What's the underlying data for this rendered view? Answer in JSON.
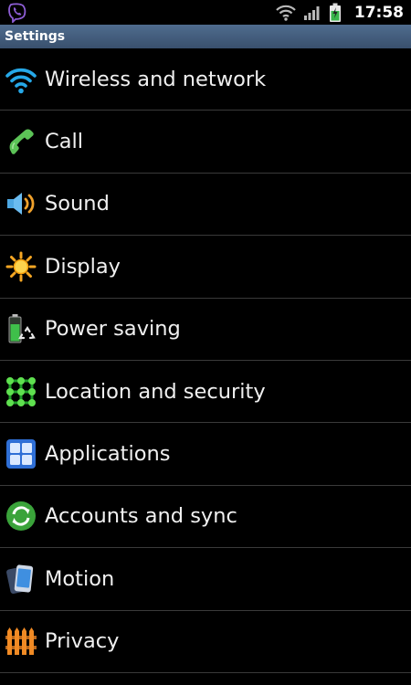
{
  "status_bar": {
    "time": "17:58",
    "icons": [
      "viber-icon",
      "wifi-signal-icon",
      "cell-signal-icon",
      "battery-charging-icon"
    ]
  },
  "title_bar": {
    "title": "Settings"
  },
  "settings": {
    "items": [
      {
        "label": "Wireless and network",
        "icon": "wifi-icon"
      },
      {
        "label": "Call",
        "icon": "phone-handset-icon"
      },
      {
        "label": "Sound",
        "icon": "speaker-icon"
      },
      {
        "label": "Display",
        "icon": "sun-icon"
      },
      {
        "label": "Power saving",
        "icon": "battery-recycle-icon"
      },
      {
        "label": "Location and security",
        "icon": "pattern-lock-icon"
      },
      {
        "label": "Applications",
        "icon": "app-grid-icon"
      },
      {
        "label": "Accounts and sync",
        "icon": "sync-icon"
      },
      {
        "label": "Motion",
        "icon": "motion-phone-icon"
      },
      {
        "label": "Privacy",
        "icon": "fence-icon"
      }
    ]
  },
  "colors": {
    "background": "#000000",
    "title_bar": "#46607f",
    "divider": "#3a3a3a",
    "text": "#f0f0f0"
  }
}
